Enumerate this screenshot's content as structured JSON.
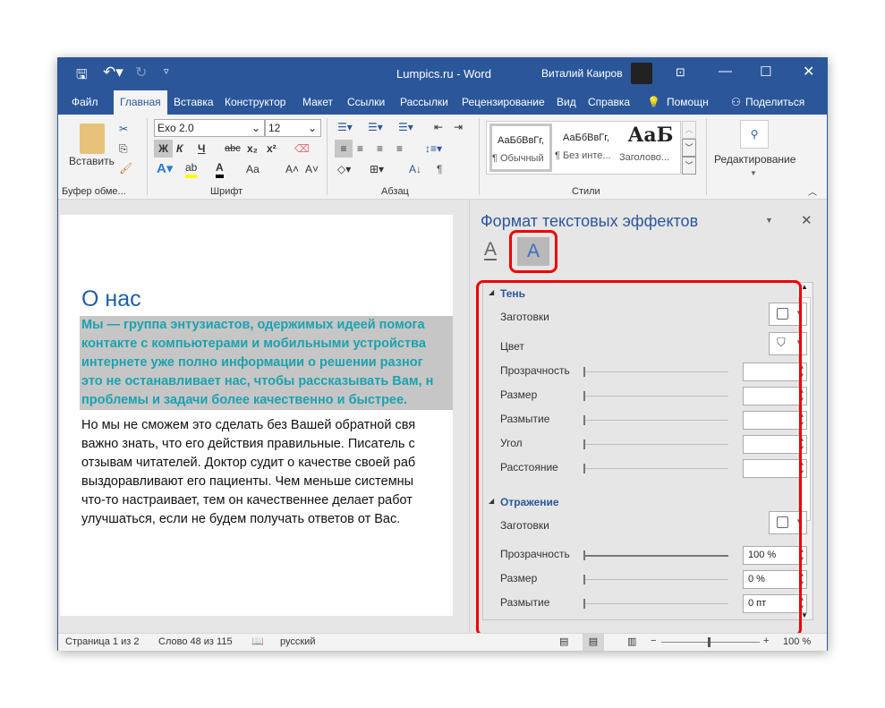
{
  "window": {
    "title": "Lumpics.ru  -  Word",
    "user": "Виталий Каиров"
  },
  "tabs": [
    {
      "label": "Файл"
    },
    {
      "label": "Главная"
    },
    {
      "label": "Вставка"
    },
    {
      "label": "Конструктор"
    },
    {
      "label": "Макет"
    },
    {
      "label": "Ссылки"
    },
    {
      "label": "Рассылки"
    },
    {
      "label": "Рецензирование"
    },
    {
      "label": "Вид"
    },
    {
      "label": "Справка"
    },
    {
      "label": "Помощн"
    },
    {
      "label": "Поделиться"
    }
  ],
  "ribbon": {
    "clipboard": {
      "paste": "Вставить",
      "group": "Буфер обме..."
    },
    "font": {
      "name": "Exo 2.0",
      "size": "12",
      "bold": "Ж",
      "italic": "К",
      "underline": "Ч",
      "strike": "abc",
      "sub": "x₂",
      "sup": "x²",
      "case": "Аа",
      "group": "Шрифт"
    },
    "paragraph": {
      "group": "Абзац"
    },
    "styles": {
      "items": [
        {
          "preview": "АаБбВвГг,",
          "name": "¶ Обычный"
        },
        {
          "preview": "АаБбВвГг,",
          "name": "¶ Без инте..."
        },
        {
          "preview": "АаБ",
          "name": "Заголово..."
        }
      ],
      "group": "Стили"
    },
    "editing": {
      "label": "Редактирование"
    }
  },
  "document": {
    "heading": "О нас",
    "selected": [
      "Мы — группа энтузиастов, одержимых идеей помога",
      "контакте с компьютерами и мобильными устройства",
      "интернете уже полно информации о решении разног",
      "это не останавливает нас, чтобы рассказывать Вам, н",
      "проблемы и задачи более качественно и быстрее."
    ],
    "body": [
      "Но мы не сможем это сделать без Вашей обратной свя",
      "важно знать, что его действия правильные. Писатель с",
      "отзывам читателей. Доктор судит о качестве своей раб",
      "выздоравливают его пациенты. Чем меньше системны",
      "что-то настраивает, тем он качественнее делает работ",
      "улучшаться, если не будем получать ответов от Вас."
    ]
  },
  "pane": {
    "title": "Формат текстовых эффектов",
    "shadow": {
      "header": "Тень",
      "presets": "Заготовки",
      "color": "Цвет",
      "rows": [
        {
          "label": "Прозрачность",
          "value": ""
        },
        {
          "label": "Размер",
          "value": ""
        },
        {
          "label": "Размытие",
          "value": ""
        },
        {
          "label": "Угол",
          "value": ""
        },
        {
          "label": "Расстояние",
          "value": ""
        }
      ]
    },
    "reflection": {
      "header": "Отражение",
      "presets": "Заготовки",
      "rows": [
        {
          "label": "Прозрачность",
          "value": "100 %",
          "level": 1
        },
        {
          "label": "Размер",
          "value": "0 %",
          "level": 0
        },
        {
          "label": "Размытие",
          "value": "0 пт",
          "level": 0
        }
      ]
    }
  },
  "status": {
    "page": "Страница 1 из 2",
    "words": "Слово 48 из 115",
    "lang": "русский",
    "zoom": "100 %"
  },
  "colors": {
    "accent": "#2b579a",
    "selected_text": "#1aa3b0",
    "highlight": "#c6c6c6",
    "callout": "#e00000"
  }
}
